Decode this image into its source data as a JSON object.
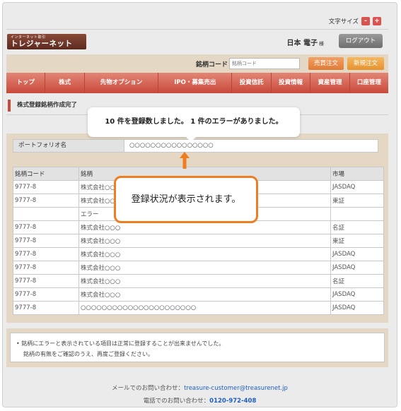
{
  "header": {
    "font_size_label": "文字サイズ",
    "font_size_minus": "-",
    "font_size_plus": "+",
    "logo_subtitle": "インターネット取引",
    "logo_title": "トレジャーネット",
    "user_name": "日本 電子",
    "user_suffix": "様",
    "logout_label": "ログアウト"
  },
  "search": {
    "label": "銘柄コード",
    "placeholder": "銘柄コード",
    "sell_label": "売買注文",
    "buy_label": "新規注文"
  },
  "nav": {
    "items": [
      "トップ",
      "株式",
      "先物オプション",
      "IPO・募集売出",
      "投資信託",
      "投資情報",
      "資産管理",
      "口座管理"
    ]
  },
  "page": {
    "title": "株式登録銘柄作成完了"
  },
  "portfolio": {
    "label": "ポートフォリオ名",
    "value": "○○○○○○○○○○○○○○○○"
  },
  "table": {
    "headers": [
      "銘柄コード",
      "銘柄",
      "市場"
    ],
    "rows": [
      [
        "9777-8",
        "株式会社○○○",
        "JASDAQ"
      ],
      [
        "9777-8",
        "株式会社○○○",
        "東証"
      ],
      [
        "",
        "エラー",
        ""
      ],
      [
        "9777-8",
        "株式会社○○○",
        "名証"
      ],
      [
        "9777-8",
        "株式会社○○○",
        "東証"
      ],
      [
        "9777-8",
        "株式会社○○○",
        "JASDAQ"
      ],
      [
        "9777-8",
        "株式会社○○○",
        "JASDAQ"
      ],
      [
        "9777-8",
        "株式会社○○○",
        "名証"
      ],
      [
        "9777-8",
        "株式会社○○○",
        "JASDAQ"
      ],
      [
        "9777-8",
        "○○○○○○○○○○○○○○○○○○○○○○",
        "JASDAQ"
      ]
    ]
  },
  "notice": {
    "line1": "• 銘柄にエラーと表示されている項目は正常に登録することが出来ませんでした。",
    "line2": "銘柄の有無をご確認のうえ、再度ご登録ください。"
  },
  "footer": {
    "mail_label": "メールでのお問い合わせ：",
    "mail": "treasure-customer@treasurenet.jp",
    "tel_label": "電話でのお問い合わせ：",
    "tel": "0120-972-408"
  },
  "annotations": {
    "callout_top": "10 件を登録数しました。 1 件のエラーがありました。",
    "callout_main": "登録状況が表示されます。"
  },
  "colors": {
    "nav": "#d35d4e",
    "accent_orange": "#ef7d22",
    "panel_bg": "#e4d8c4",
    "link": "#1f5fbf"
  }
}
